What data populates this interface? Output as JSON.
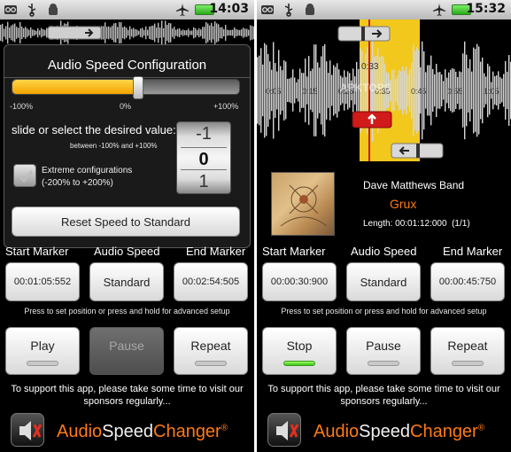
{
  "left": {
    "status_time": "14:03",
    "dialog": {
      "title": "Audio Speed Configuration",
      "slider_min": "-100%",
      "slider_mid": "0%",
      "slider_max": "+100%",
      "slider_value": 0.55,
      "prompt": "slide or select the desired value:",
      "range_hint": "between -100% and +100%",
      "picker_values": [
        "-1",
        "0",
        "1"
      ],
      "extreme_label": "Extreme configurations",
      "extreme_range": "(-200% to +200%)",
      "reset_label": "Reset Speed to Standard"
    },
    "start_marker_label": "Start Marker",
    "audio_speed_label": "Audio Speed",
    "end_marker_label": "End Marker",
    "start_marker_value": "00:01:05:552",
    "audio_speed_value": "Standard",
    "end_marker_value": "00:02:54:505",
    "hint": "Press to set position or press and hold for advanced setup",
    "play_label": "Play",
    "pause_label": "Pause",
    "repeat_label": "Repeat",
    "support_text_1": "To support this app, please take some time to visit our",
    "support_text_2": "sponsors regularly..."
  },
  "right": {
    "status_time": "15:32",
    "wave_marks": [
      "0:05",
      "0:15",
      "0:25",
      "0:35",
      "0:45",
      "0:55",
      "1:05"
    ],
    "cursor_time": "0:33",
    "watermark": "APKTOPS",
    "artist": "Dave Matthews Band",
    "track": "Grux",
    "length": "Length: 00:01:12:000  (1/1)",
    "start_marker_label": "Start Marker",
    "audio_speed_label": "Audio Speed",
    "end_marker_label": "End Marker",
    "start_marker_value": "00:00:30:900",
    "audio_speed_value": "Standard",
    "end_marker_value": "00:00:45:750",
    "hint": "Press to set position or press and hold for advanced setup",
    "stop_label": "Stop",
    "pause_label": "Pause",
    "repeat_label": "Repeat",
    "support_text_1": "To support this app, please take some time to visit our",
    "support_text_2": "sponsors regularly..."
  },
  "brand": {
    "part1": "Audio",
    "part2": "Speed",
    "part3": "Changer",
    "mark": "®"
  },
  "colors": {
    "accent_orange": "#ff7a14",
    "selection_yellow": "#f2c81c",
    "indicator_green": "#3cc41a"
  }
}
